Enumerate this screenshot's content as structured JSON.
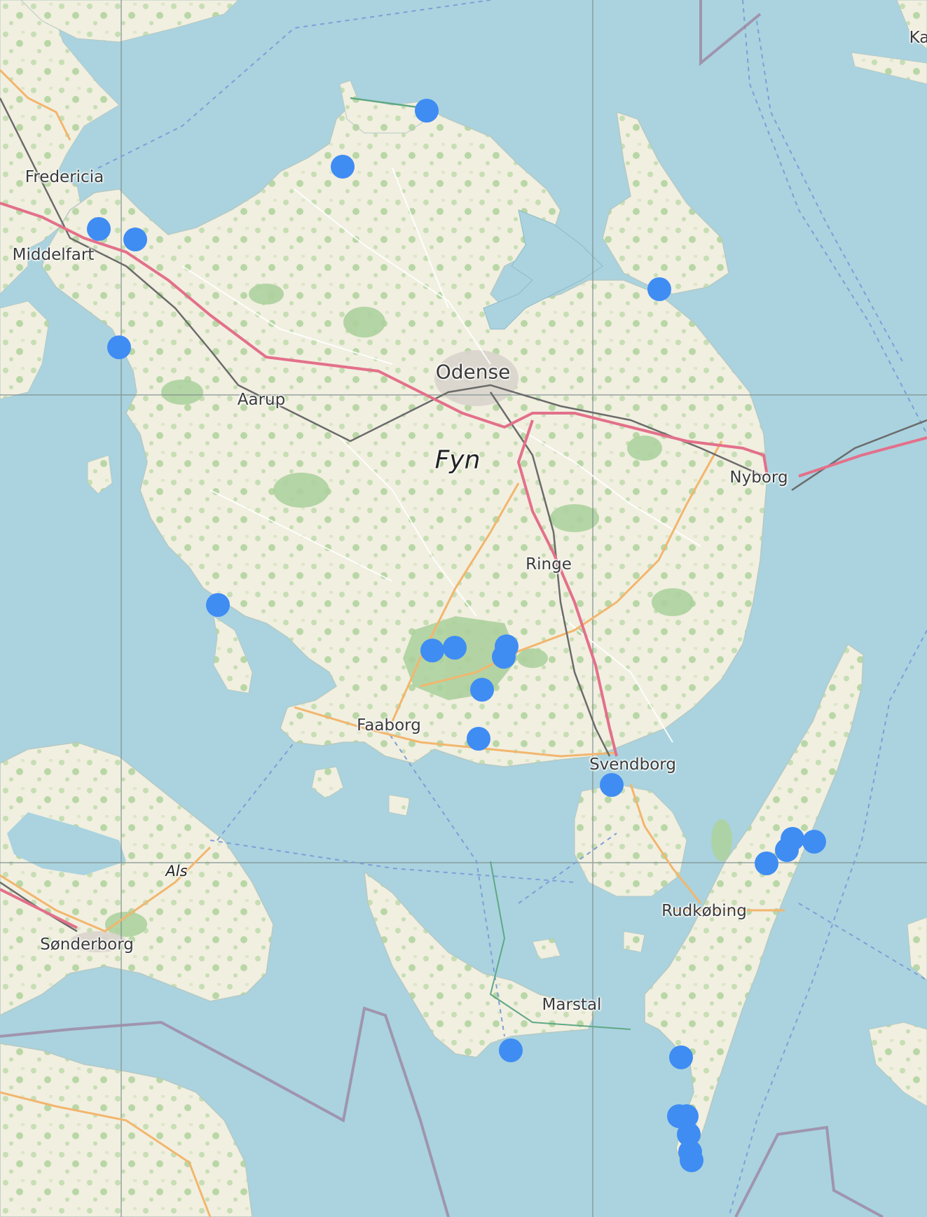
{
  "map": {
    "colors": {
      "water": "#aad3df",
      "land": "#f1efe0",
      "forest": "#add19e",
      "motorway": "#e3708a",
      "primary": "#f2b66e",
      "railway": "#777777",
      "border": "#9e8aa6",
      "marker": "#3f8cf3"
    },
    "labels": [
      {
        "id": "fredericia",
        "text": "Fredericia",
        "kind": "city"
      },
      {
        "id": "middelfart",
        "text": "Middelfart",
        "kind": "city"
      },
      {
        "id": "aarup",
        "text": "Aarup",
        "kind": "city"
      },
      {
        "id": "odense",
        "text": "Odense",
        "kind": "city-major"
      },
      {
        "id": "fyn",
        "text": "Fyn",
        "kind": "region"
      },
      {
        "id": "nyborg",
        "text": "Nyborg",
        "kind": "city"
      },
      {
        "id": "ringe",
        "text": "Ringe",
        "kind": "city"
      },
      {
        "id": "faaborg",
        "text": "Faaborg",
        "kind": "city"
      },
      {
        "id": "svendborg",
        "text": "Svendborg",
        "kind": "city"
      },
      {
        "id": "als",
        "text": "Als",
        "kind": "island"
      },
      {
        "id": "sonderborg",
        "text": "Sønderborg",
        "kind": "city"
      },
      {
        "id": "rudkobing",
        "text": "Rudkøbing",
        "kind": "city"
      },
      {
        "id": "marstal",
        "text": "Marstal",
        "kind": "city"
      },
      {
        "id": "ka",
        "text": "Ka",
        "kind": "city-partial"
      }
    ],
    "markers_count": 30
  }
}
